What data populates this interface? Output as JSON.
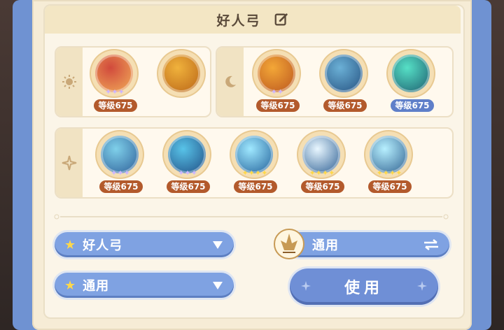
{
  "header": {
    "title": "好人弓",
    "edit_icon": "edit-icon"
  },
  "groups": {
    "sun": {
      "icon": "sun-icon",
      "slots": [
        {
          "level": "等级675",
          "stars": "✦✦✦",
          "badge": "brown",
          "colors": [
            "#d14a3c",
            "#f2b05a"
          ],
          "icon": "harp-icon"
        },
        {
          "level": "",
          "stars": "",
          "badge": "",
          "colors": [
            "#f0b23c",
            "#b86316"
          ],
          "icon": "golden-crest-icon"
        }
      ]
    },
    "moon": {
      "icon": "moon-icon",
      "slots": [
        {
          "level": "等级675",
          "stars": "✦✦",
          "badge": "brown",
          "colors": [
            "#f3a737",
            "#b9531e"
          ],
          "icon": "music-notes-icon"
        },
        {
          "level": "等级675",
          "stars": "",
          "badge": "brown",
          "colors": [
            "#6bb0d6",
            "#234f7e"
          ],
          "icon": "wolf-icon"
        },
        {
          "level": "等级675",
          "stars": "",
          "badge": "blue",
          "colors": [
            "#56e0c6",
            "#1b5a6c"
          ],
          "icon": "star-dragon-icon"
        }
      ]
    },
    "star": {
      "icon": "sparkle-icon",
      "slots": [
        {
          "level": "等级675",
          "stars": "✦✦✦",
          "badge": "brown",
          "colors": [
            "#7fd0ea",
            "#2c5c96"
          ],
          "icon": "archer-icon"
        },
        {
          "level": "等级675",
          "stars": "✦✦✦",
          "badge": "brown",
          "colors": [
            "#58c3e8",
            "#1f4b82"
          ],
          "icon": "arrow-rain-icon"
        },
        {
          "level": "等级675",
          "stars": "✦✦✦✦",
          "badge": "brown",
          "colors": [
            "#9fe8ff",
            "#1e5d97"
          ],
          "icon": "burst-icon"
        },
        {
          "level": "等级675",
          "stars": "✦✦✦✦",
          "badge": "brown",
          "colors": [
            "#e9f7ff",
            "#275a8f"
          ],
          "icon": "starburst-icon"
        },
        {
          "level": "等级675",
          "stars": "✦✦✦✦",
          "badge": "brown",
          "colors": [
            "#b7f0ff",
            "#2b5c8c"
          ],
          "icon": "crystal-icon"
        }
      ]
    }
  },
  "controls": {
    "preset_dropdown": {
      "label": "好人弓"
    },
    "type_dropdown": {
      "label": "通用"
    },
    "swap": {
      "label": "通用"
    },
    "use_button": {
      "label": "使用"
    }
  },
  "colors": {
    "accent_blue": "#7fa2e2",
    "badge_brown": "#b35a2c",
    "badge_blue": "#5f7fc9",
    "star_pink": "#cdb6ff",
    "star_gold": "#ffd84a"
  }
}
